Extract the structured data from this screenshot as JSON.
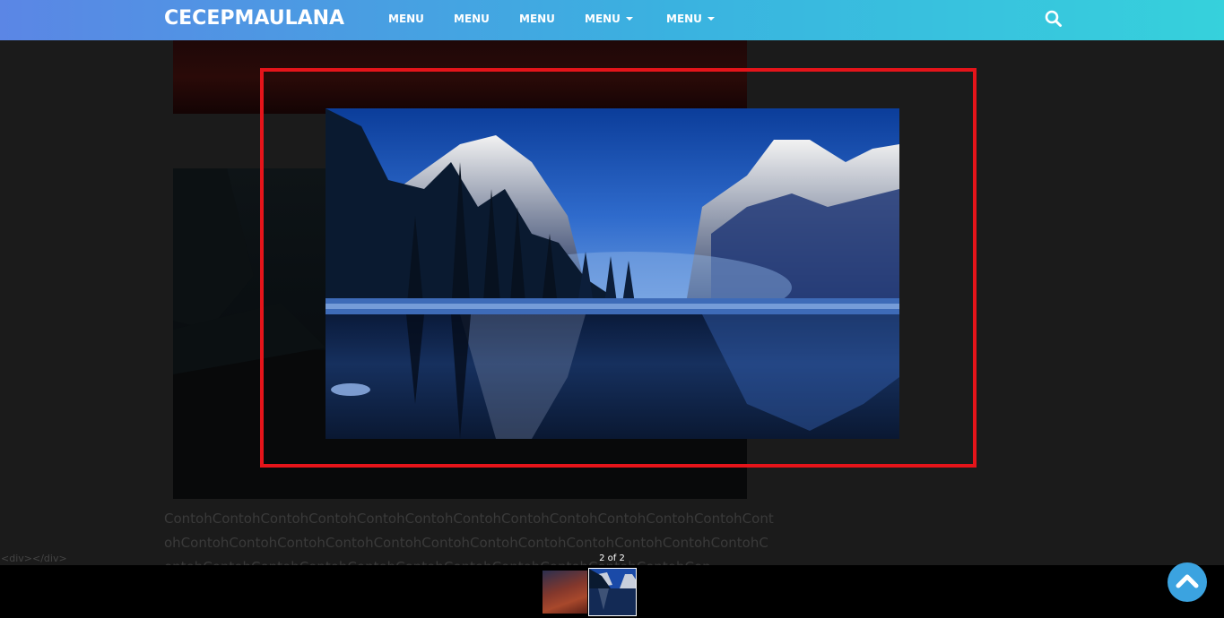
{
  "navbar": {
    "brand": "CECEPMAULANA",
    "menu": [
      {
        "label": "MENU",
        "has_dropdown": false
      },
      {
        "label": "MENU",
        "has_dropdown": false
      },
      {
        "label": "MENU",
        "has_dropdown": false
      },
      {
        "label": "MENU",
        "has_dropdown": true
      },
      {
        "label": "MENU",
        "has_dropdown": true
      }
    ],
    "search_icon": "search-icon",
    "gradient_colors": [
      "#5b86e5",
      "#36d1dc"
    ]
  },
  "article": {
    "body_text": "ContohContohContohContohContohContohContohContohContohContohContohContohContohContohContohContohContohContohContohContohContohContohContohContohContohContohContohContohContohContohContohContohContohContohContohContohCon",
    "code_snippet": "<div></div>"
  },
  "lightbox": {
    "counter": "2 of 2",
    "highlight_color": "#e5141a",
    "current_image": "winter-mountain-lake-image",
    "thumbnails": [
      {
        "name": "sunset-landscape-thumbnail",
        "selected": false
      },
      {
        "name": "winter-mountain-lake-thumbnail",
        "selected": true
      }
    ]
  },
  "scroll_top": {
    "icon": "chevron-up-icon",
    "color": "#3ba3e0"
  }
}
